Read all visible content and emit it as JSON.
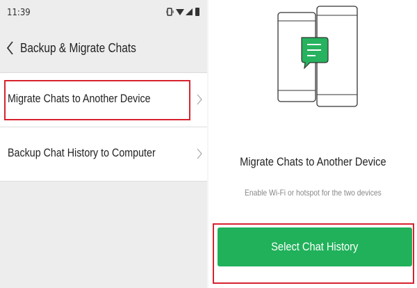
{
  "status_bar": {
    "time": "11:39",
    "icons": [
      "vibrate-icon",
      "wifi-icon",
      "signal-icon",
      "battery-icon"
    ]
  },
  "left_screen": {
    "header": {
      "title": "Backup & Migrate Chats"
    },
    "options": [
      {
        "label": "Migrate Chats to Another Device",
        "highlighted": true
      },
      {
        "label": "Backup Chat History to Computer",
        "highlighted": false
      }
    ]
  },
  "right_screen": {
    "title": "Migrate Chats to Another Device",
    "subtitle": "Enable Wi-Fi or hotspot for the two devices",
    "button_label": "Select Chat History",
    "highlighted": true
  },
  "colors": {
    "accent_green": "#20b15a",
    "highlight_red": "#d6232e",
    "bubble_green": "#26b25e",
    "left_background": "#ededed"
  }
}
